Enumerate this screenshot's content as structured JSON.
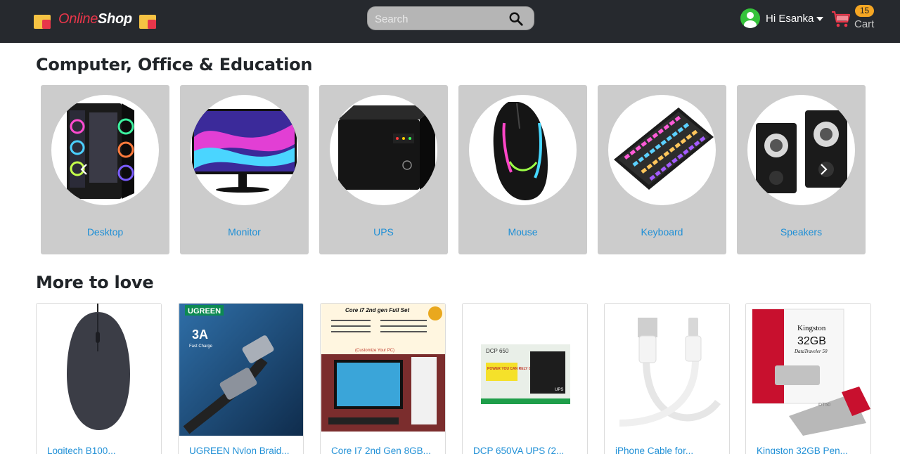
{
  "header": {
    "brand_part1": "Online",
    "brand_part2": "Shop",
    "search_placeholder": "Search",
    "user_greeting": "Hi Esanka",
    "cart_count": "15",
    "cart_label": "Cart"
  },
  "categories_section": {
    "title": "Computer, Office & Education",
    "items": [
      {
        "label": "Desktop",
        "icon": "desktop-pc-icon"
      },
      {
        "label": "Monitor",
        "icon": "monitor-icon"
      },
      {
        "label": "UPS",
        "icon": "ups-icon"
      },
      {
        "label": "Mouse",
        "icon": "gaming-mouse-icon"
      },
      {
        "label": "Keyboard",
        "icon": "keyboard-icon"
      },
      {
        "label": "Speakers",
        "icon": "speakers-icon"
      }
    ]
  },
  "products_section": {
    "title": "More to love",
    "items": [
      {
        "title": "Logitech B100..."
      },
      {
        "title": "UGREEN Nylon Braid...",
        "image_text": [
          "UGREEN",
          "3A",
          "Fast Charge"
        ]
      },
      {
        "title": "Core I7 2nd Gen 8GB...",
        "image_text": [
          "Core i7 2nd gen Full Set",
          "(Customize Your PC)"
        ]
      },
      {
        "title": "DCP 650VA UPS (2...",
        "image_text": [
          "DCP 650",
          "POWER YOU CAN RELY ON!",
          "UPS"
        ]
      },
      {
        "title": "iPhone Cable for..."
      },
      {
        "title": "Kingston 32GB Pen...",
        "image_text": [
          "Kingston",
          "32GB",
          "DataTraveler 50",
          "DT50"
        ]
      }
    ]
  },
  "colors": {
    "header_bg": "#26292e",
    "brand_accent": "#e8364a",
    "link": "#1e8fd6",
    "card_bg": "#cccccc",
    "badge": "#f5a623"
  }
}
